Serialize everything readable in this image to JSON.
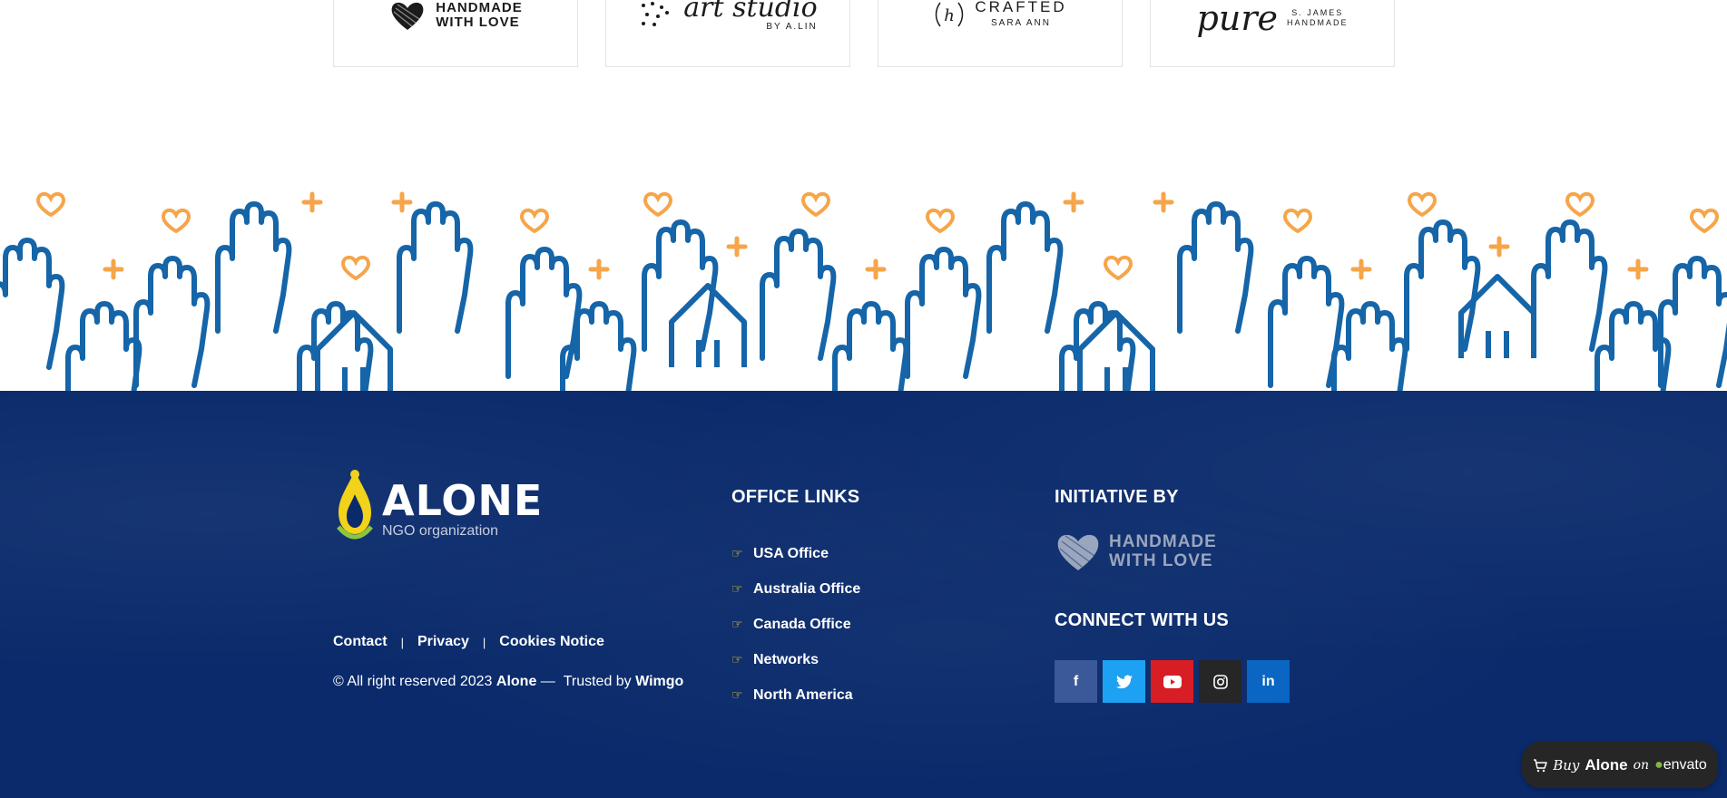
{
  "partners": [
    {
      "line1": "HANDMADE",
      "line2": "WITH LOVE"
    },
    {
      "script": "art studio",
      "small": "BY A.LIN"
    },
    {
      "letter": "h",
      "line1": "CRAFTED",
      "line2": "SARA ANN"
    },
    {
      "script": "pure",
      "small1": "S. JAMES",
      "small2": "HANDMADE"
    }
  ],
  "footer": {
    "brand": {
      "name": "ALONE",
      "sub": "NGO organization"
    },
    "legal_links": [
      "Contact",
      "Privacy",
      "Cookies Notice"
    ],
    "copyright": {
      "prefix": "© All right reserved 2023",
      "brand": "Alone",
      "dash": "—",
      "trusted": "Trusted by",
      "company": "Wimgo"
    },
    "office_links": {
      "title": "OFFICE LINKS",
      "items": [
        "USA Office",
        "Australia Office",
        "Canada Office",
        "Networks",
        "North America"
      ]
    },
    "initiative": {
      "title": "INITIATIVE BY",
      "line1": "HANDMADE",
      "line2": "WITH LOVE"
    },
    "connect": {
      "title": "CONNECT WITH US"
    },
    "socials": [
      {
        "name": "facebook",
        "glyph": "f"
      },
      {
        "name": "twitter",
        "glyph": "🐦"
      },
      {
        "name": "youtube",
        "glyph": "▶"
      },
      {
        "name": "instagram",
        "glyph": "◎"
      },
      {
        "name": "linkedin",
        "glyph": "in"
      }
    ]
  },
  "envato": {
    "buy": "Buy",
    "name": "Alone",
    "on": "on",
    "brand": "envato"
  },
  "colors": {
    "footer_bg": "#0a2a6b",
    "hand_blue": "#1565a8",
    "heart_orange": "#f6a54a",
    "accent_yellow": "#f2d21a"
  }
}
